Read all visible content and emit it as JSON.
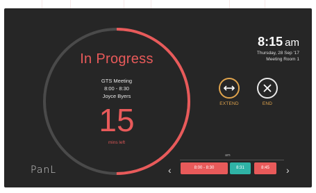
{
  "meeting": {
    "status": "In Progress",
    "title": "GTS Meeting",
    "time_range": "8:00 - 8:30",
    "organizer": "Joyce Byers",
    "minutes_left": "15",
    "minutes_left_label": "mins left",
    "progress": 0.5
  },
  "clock": {
    "time": "8:15",
    "ampm": "am",
    "date": "Thursday, 28 Sep '17",
    "room": "Meeting Room 1"
  },
  "actions": {
    "extend_label": "EXTEND",
    "end_label": "END"
  },
  "brand": {
    "logo_text": "PanL"
  },
  "timeline": {
    "label": "am",
    "prev_icon": "chevron-left-icon",
    "next_icon": "chevron-right-icon",
    "slots": [
      {
        "label": "8:00 - 8:30",
        "status": "current"
      },
      {
        "label": "8:31",
        "status": "available"
      },
      {
        "label": "8:45",
        "status": "booked"
      }
    ]
  },
  "colors": {
    "background": "#262626",
    "accent_red": "#e85a5a",
    "accent_amber": "#e0a44d",
    "ring_track": "#4a4a4a",
    "slot_available": "#2fb3a6"
  }
}
